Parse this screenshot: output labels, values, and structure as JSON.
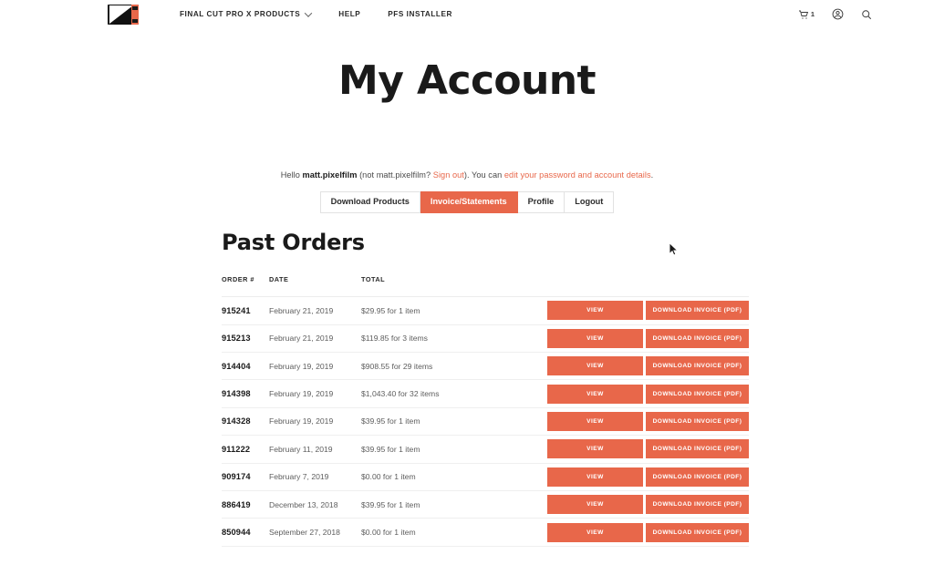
{
  "header": {
    "logo_alt": "Pixel Film Studios logo",
    "nav": [
      {
        "label": "FINAL CUT PRO X PRODUCTS",
        "has_dropdown": true
      },
      {
        "label": "HELP",
        "has_dropdown": false
      },
      {
        "label": "PFS INSTALLER",
        "has_dropdown": false
      }
    ],
    "cart_count": "1",
    "icons": {
      "cart": "cart-icon",
      "account": "account-circle-icon",
      "search": "search-icon"
    }
  },
  "page": {
    "title": "My Account"
  },
  "greeting": {
    "prefix": "Hello ",
    "username": "matt.pixelfilm",
    "middle": " (not matt.pixelfilm? ",
    "signout_label": "Sign out",
    "after_signout": "). You can ",
    "edit_link_label": "edit your password and account details",
    "suffix": "."
  },
  "tabs": [
    {
      "label": "Download Products",
      "active": false
    },
    {
      "label": "Invoice/Statements",
      "active": true
    },
    {
      "label": "Profile",
      "active": false
    },
    {
      "label": "Logout",
      "active": false
    }
  ],
  "orders_section": {
    "title": "Past Orders",
    "columns": [
      "ORDER #",
      "DATE",
      "TOTAL",
      ""
    ],
    "button_labels": {
      "view": "VIEW",
      "download": "DOWNLOAD INVOICE (PDF)"
    },
    "rows": [
      {
        "order": "915241",
        "date": "February 21, 2019",
        "total": "$29.95 for 1 item"
      },
      {
        "order": "915213",
        "date": "February 21, 2019",
        "total": "$119.85 for 3 items"
      },
      {
        "order": "914404",
        "date": "February 19, 2019",
        "total": "$908.55 for 29 items"
      },
      {
        "order": "914398",
        "date": "February 19, 2019",
        "total": "$1,043.40 for 32 items"
      },
      {
        "order": "914328",
        "date": "February 19, 2019",
        "total": "$39.95 for 1 item"
      },
      {
        "order": "911222",
        "date": "February 11, 2019",
        "total": "$39.95 for 1 item"
      },
      {
        "order": "909174",
        "date": "February 7, 2019",
        "total": "$0.00 for 1 item"
      },
      {
        "order": "886419",
        "date": "December 13, 2018",
        "total": "$39.95 for 1 item"
      },
      {
        "order": "850944",
        "date": "September 27, 2018",
        "total": "$0.00 for 1 item"
      }
    ]
  },
  "colors": {
    "accent": "#e8674a",
    "text": "#333333",
    "heading": "#1a1a1a",
    "border": "#efefef"
  }
}
